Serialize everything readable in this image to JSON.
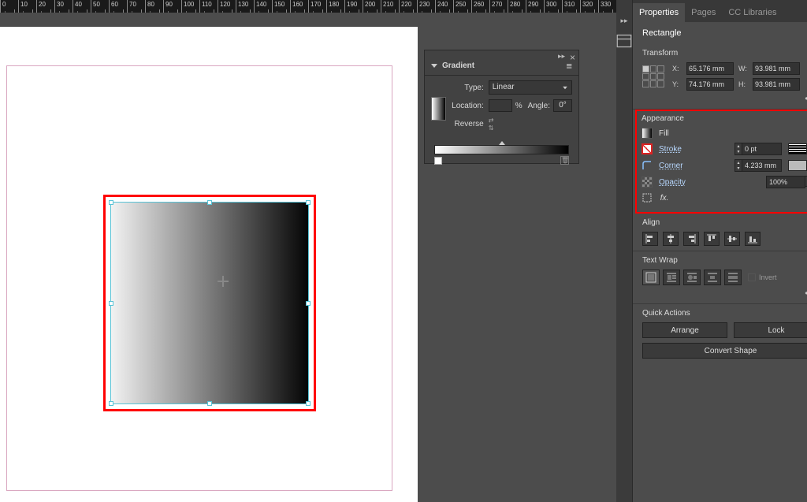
{
  "ruler": {
    "start": 0,
    "step": 10,
    "count": 34
  },
  "gradient_panel": {
    "title": "Gradient",
    "type_label": "Type:",
    "type_value": "Linear",
    "location_label": "Location:",
    "percent": "%",
    "angle_label": "Angle:",
    "angle_value": "0°",
    "reverse_label": "Reverse"
  },
  "properties": {
    "tabs": [
      "Properties",
      "Pages",
      "CC Libraries"
    ],
    "object_type": "Rectangle",
    "transform": {
      "title": "Transform",
      "x": "65.176 mm",
      "y": "74.176 mm",
      "w": "93.981 mm",
      "h": "93.981 mm",
      "labels": {
        "x": "X:",
        "y": "Y:",
        "w": "W:",
        "h": "H:"
      }
    },
    "appearance": {
      "title": "Appearance",
      "fill_label": "Fill",
      "stroke_label": "Stroke",
      "stroke_value": "0 pt",
      "corner_label": "Corner",
      "corner_value": "4.233 mm",
      "opacity_label": "Opacity",
      "opacity_value": "100%"
    },
    "align": {
      "title": "Align"
    },
    "wrap": {
      "title": "Text Wrap",
      "invert": "Invert"
    },
    "quick": {
      "title": "Quick Actions",
      "arrange": "Arrange",
      "lock": "Lock",
      "convert": "Convert Shape"
    }
  }
}
